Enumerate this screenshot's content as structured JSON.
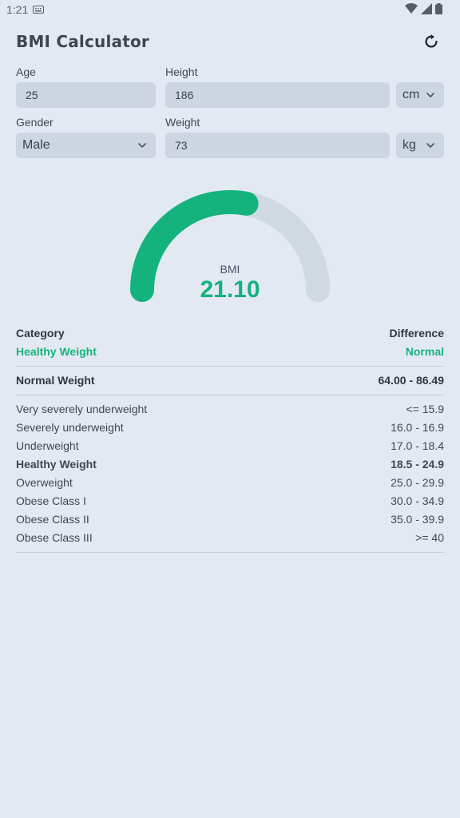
{
  "status_bar": {
    "time": "1:21"
  },
  "header": {
    "title": "BMI Calculator"
  },
  "form": {
    "age_label": "Age",
    "age_value": "25",
    "height_label": "Height",
    "height_value": "186",
    "height_unit": "cm",
    "gender_label": "Gender",
    "gender_value": "Male",
    "weight_label": "Weight",
    "weight_value": "73",
    "weight_unit": "kg"
  },
  "gauge": {
    "label": "BMI",
    "value_text": "21.10",
    "fill_fraction": 0.56,
    "fill_color": "#14b37d",
    "track_color": "#d0d8e2"
  },
  "summary": {
    "category_header": "Category",
    "difference_header": "Difference",
    "category_value": "Healthy Weight",
    "difference_value": "Normal",
    "normal_weight_label": "Normal Weight",
    "normal_weight_range": "64.00 - 86.49"
  },
  "categories": [
    {
      "name": "Very severely underweight",
      "range": "<= 15.9",
      "active": false
    },
    {
      "name": "Severely underweight",
      "range": "16.0 - 16.9",
      "active": false
    },
    {
      "name": "Underweight",
      "range": "17.0 - 18.4",
      "active": false
    },
    {
      "name": "Healthy Weight",
      "range": "18.5 - 24.9",
      "active": true
    },
    {
      "name": "Overweight",
      "range": "25.0 - 29.9",
      "active": false
    },
    {
      "name": "Obese Class I",
      "range": "30.0 - 34.9",
      "active": false
    },
    {
      "name": "Obese Class II",
      "range": "35.0 - 39.9",
      "active": false
    },
    {
      "name": "Obese Class III",
      "range": ">= 40",
      "active": false
    }
  ]
}
